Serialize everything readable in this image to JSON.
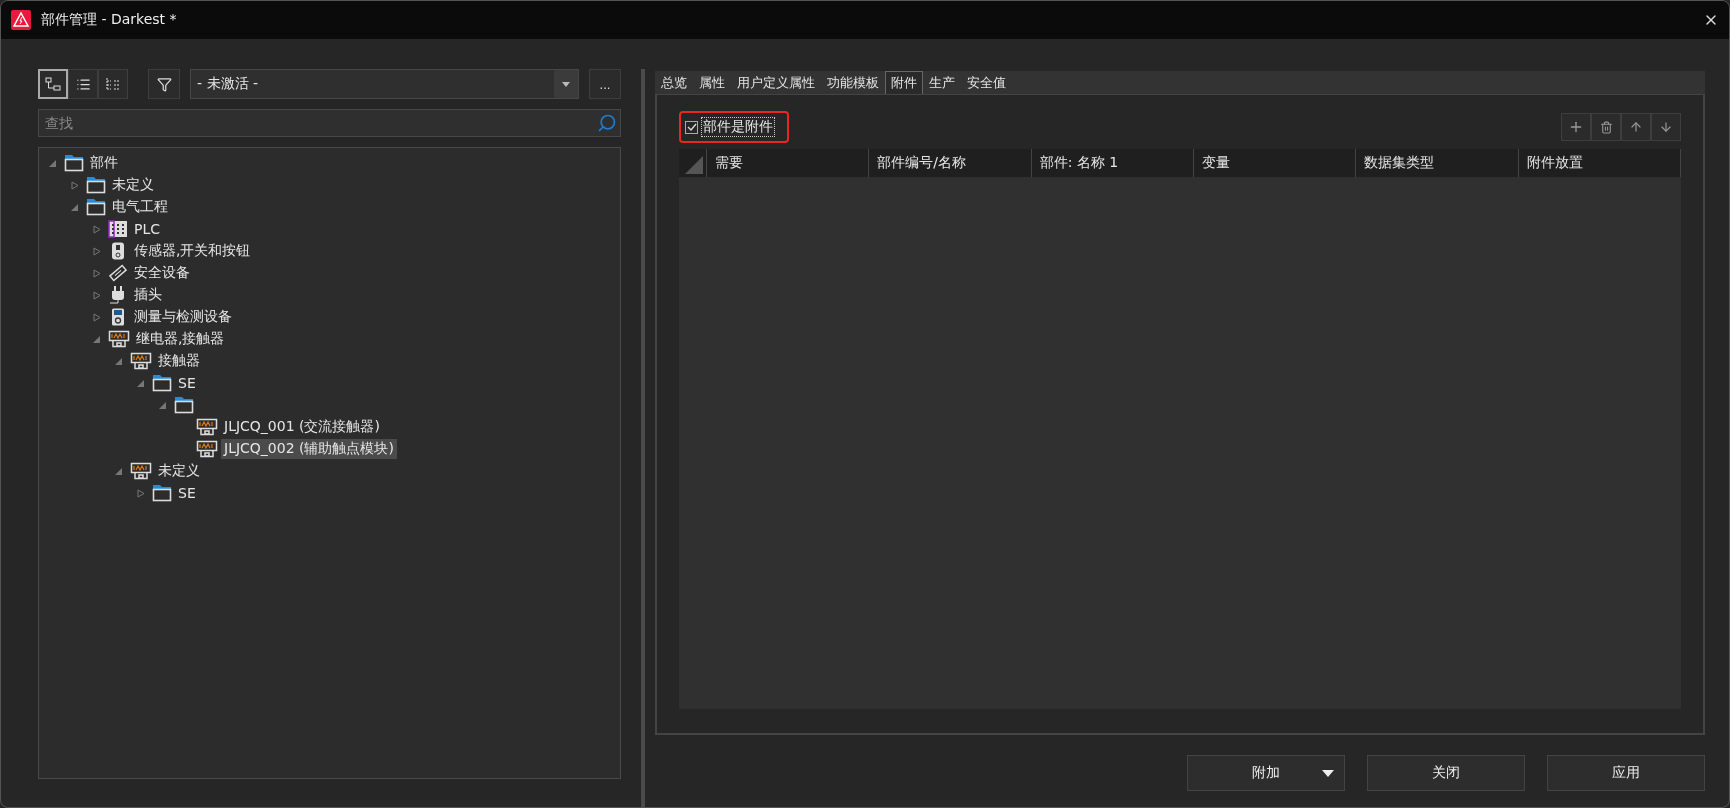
{
  "window": {
    "title": "部件管理 - Darkest *"
  },
  "toolbar": {
    "view_buttons": [
      {
        "kind": "tree",
        "selected": true
      },
      {
        "kind": "list",
        "selected": false
      },
      {
        "kind": "detail",
        "selected": false
      }
    ],
    "filter_value": "- 未激活 -",
    "more_label": "..."
  },
  "search": {
    "placeholder": "查找"
  },
  "tree": [
    {
      "label": "部件",
      "kind": "folder",
      "expanded": true,
      "selected": false,
      "children": [
        {
          "label": "未定义",
          "kind": "folder",
          "expanded": false,
          "selected": false
        },
        {
          "label": "电气工程",
          "kind": "folder",
          "expanded": true,
          "selected": false,
          "children": [
            {
              "label": "PLC",
              "kind": "plc",
              "expanded": false,
              "selected": false
            },
            {
              "label": "传感器,开关和按钮",
              "kind": "sensor",
              "expanded": false,
              "selected": false
            },
            {
              "label": "安全设备",
              "kind": "safety",
              "expanded": false,
              "selected": false
            },
            {
              "label": "插头",
              "kind": "plug",
              "expanded": false,
              "selected": false
            },
            {
              "label": "测量与检测设备",
              "kind": "meter",
              "expanded": false,
              "selected": false
            },
            {
              "label": "继电器,接触器",
              "kind": "relay",
              "expanded": true,
              "selected": false,
              "children": [
                {
                  "label": "接触器",
                  "kind": "relay",
                  "expanded": true,
                  "selected": false,
                  "children": [
                    {
                      "label": "SE",
                      "kind": "folder",
                      "expanded": true,
                      "selected": false,
                      "children": [
                        {
                          "kind": "folder",
                          "expanded": true,
                          "children": [
                            {
                              "label": "JLJCQ_001 (交流接触器)",
                              "kind": "relay",
                              "selected": false
                            },
                            {
                              "label": "JLJCQ_002 (辅助触点模块)",
                              "kind": "relay",
                              "selected": true
                            }
                          ]
                        }
                      ]
                    }
                  ]
                },
                {
                  "label": "未定义",
                  "kind": "relay",
                  "expanded": true,
                  "selected": false,
                  "children": [
                    {
                      "label": "SE",
                      "kind": "folder",
                      "expanded": false,
                      "selected": false
                    }
                  ]
                }
              ]
            }
          ]
        }
      ]
    }
  ],
  "tabs": [
    {
      "label": "总览",
      "selected": false
    },
    {
      "label": "属性",
      "selected": false
    },
    {
      "label": "用户定义属性",
      "selected": false
    },
    {
      "label": "功能模板",
      "selected": false
    },
    {
      "label": "附件",
      "selected": true
    },
    {
      "label": "生产",
      "selected": false
    },
    {
      "label": "安全值",
      "selected": false
    }
  ],
  "accessory_checkbox": {
    "label": "部件是附件",
    "checked": true,
    "highlighted": true
  },
  "table_tools": [
    {
      "kind": "add"
    },
    {
      "kind": "delete"
    },
    {
      "kind": "up"
    },
    {
      "kind": "down"
    }
  ],
  "table": {
    "columns": [
      "需要",
      "部件编号/名称",
      "部件: 名称 1",
      "变量",
      "数据集类型",
      "附件放置"
    ]
  },
  "buttons": [
    {
      "label": "附加",
      "kind": "dropdown"
    },
    {
      "label": "关闭",
      "kind": "plain"
    },
    {
      "label": "应用",
      "kind": "plain"
    }
  ]
}
